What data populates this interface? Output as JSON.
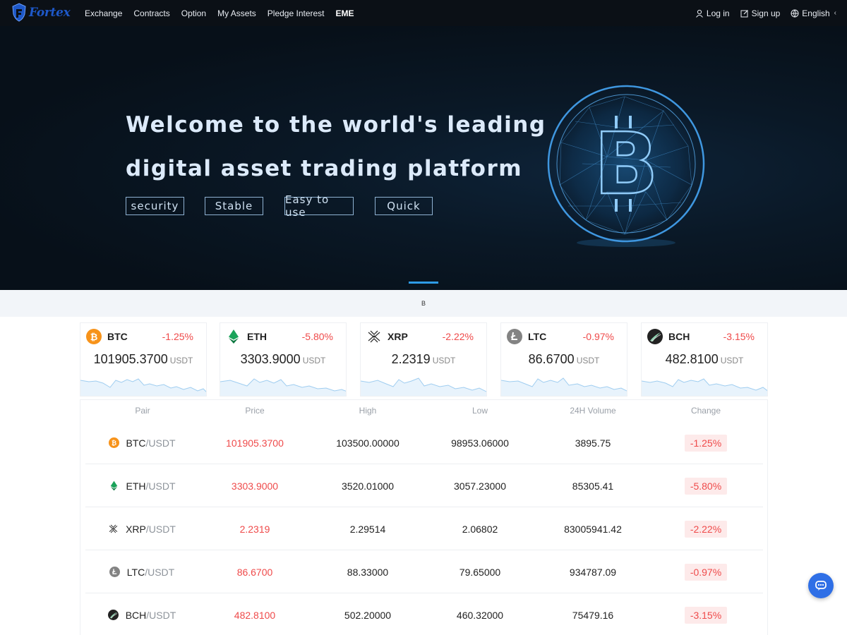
{
  "nav": {
    "logo_text": "Fortex",
    "items": [
      {
        "label": "Exchange"
      },
      {
        "label": "Contracts"
      },
      {
        "label": "Option"
      },
      {
        "label": "My Assets"
      },
      {
        "label": "Pledge Interest"
      },
      {
        "label": "EME"
      }
    ],
    "login_label": "Log in",
    "signup_label": "Sign up",
    "language_label": "English"
  },
  "hero": {
    "title_line1": "Welcome to the world's leading",
    "title_line2": "digital asset trading platform",
    "tags": [
      "security",
      "Stable",
      "Easy to use",
      "Quick"
    ],
    "coin_icon": "bitcoin-globe-icon"
  },
  "strip": {
    "text": "B"
  },
  "tickers": [
    {
      "symbol": "BTC",
      "change": "-1.25%",
      "price": "101905.3700",
      "unit": "USDT",
      "icon": "btc-icon",
      "color": "#f7931a"
    },
    {
      "symbol": "ETH",
      "change": "-5.80%",
      "price": "3303.9000",
      "unit": "USDT",
      "icon": "eth-icon",
      "color": "#1aa35a"
    },
    {
      "symbol": "XRP",
      "change": "-2.22%",
      "price": "2.2319",
      "unit": "USDT",
      "icon": "xrp-icon",
      "color": "#333333"
    },
    {
      "symbol": "LTC",
      "change": "-0.97%",
      "price": "86.6700",
      "unit": "USDT",
      "icon": "ltc-icon",
      "color": "#838383"
    },
    {
      "symbol": "BCH",
      "change": "-3.15%",
      "price": "482.8100",
      "unit": "USDT",
      "icon": "bch-icon",
      "color": "#222222"
    }
  ],
  "table": {
    "headers": [
      "Pair",
      "Price",
      "High",
      "Low",
      "24H Volume",
      "Change"
    ],
    "rows": [
      {
        "base": "BTC",
        "quote": "/USDT",
        "price": "101905.3700",
        "high": "103500.00000",
        "low": "98953.06000",
        "volume": "3895.75",
        "change": "-1.25%"
      },
      {
        "base": "ETH",
        "quote": "/USDT",
        "price": "3303.9000",
        "high": "3520.01000",
        "low": "3057.23000",
        "volume": "85305.41",
        "change": "-5.80%"
      },
      {
        "base": "XRP",
        "quote": "/USDT",
        "price": "2.2319",
        "high": "2.29514",
        "low": "2.06802",
        "volume": "83005941.42",
        "change": "-2.22%"
      },
      {
        "base": "LTC",
        "quote": "/USDT",
        "price": "86.6700",
        "high": "88.33000",
        "low": "79.65000",
        "volume": "934787.09",
        "change": "-0.97%"
      },
      {
        "base": "BCH",
        "quote": "/USDT",
        "price": "482.8100",
        "high": "502.20000",
        "low": "460.32000",
        "volume": "75479.16",
        "change": "-3.15%"
      }
    ]
  },
  "colors": {
    "nav_bg": "#0b1016",
    "hero_bg": "#071019",
    "accent": "#2e9be6",
    "negative": "#ef4a4a",
    "negative_bg": "#fdeaea",
    "chat_fab": "#2f6fe6"
  },
  "chat": {
    "icon": "chat-icon"
  }
}
